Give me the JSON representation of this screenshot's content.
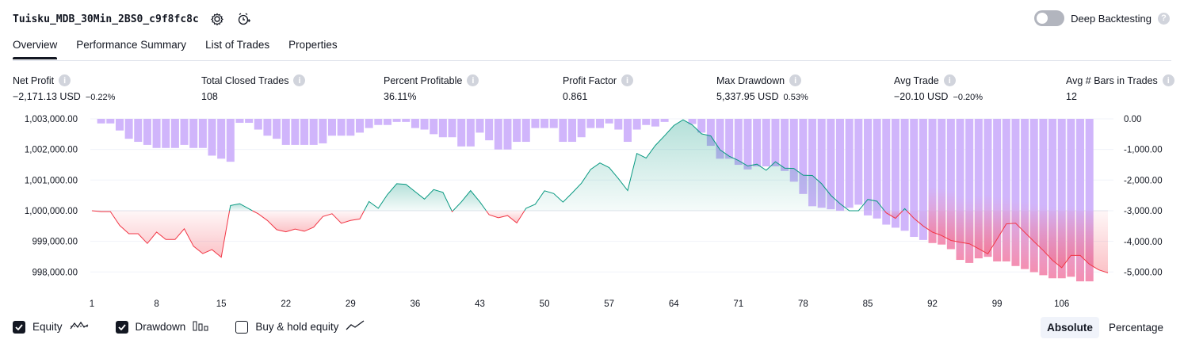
{
  "strategy": {
    "title": "Tuisku_MDB_30Min_2BS0_c9f8fc8c",
    "settings_icon": "settings-gear-icon",
    "alert_icon": "add-alert-clock-icon"
  },
  "deep_backtesting": {
    "label": "Deep Backtesting",
    "enabled": false,
    "help": "?"
  },
  "tabs": [
    {
      "label": "Overview",
      "active": true
    },
    {
      "label": "Performance Summary",
      "active": false
    },
    {
      "label": "List of Trades",
      "active": false
    },
    {
      "label": "Properties",
      "active": false
    }
  ],
  "metrics": {
    "net_profit": {
      "label": "Net Profit",
      "value": "−2,171.13 USD",
      "pct": "−0.22%"
    },
    "total_closed_trades": {
      "label": "Total Closed Trades",
      "value": "108"
    },
    "percent_profitable": {
      "label": "Percent Profitable",
      "value": "36.11%"
    },
    "profit_factor": {
      "label": "Profit Factor",
      "value": "0.861"
    },
    "max_drawdown": {
      "label": "Max Drawdown",
      "value": "5,337.95 USD",
      "pct": "0.53%"
    },
    "avg_trade": {
      "label": "Avg Trade",
      "value": "−20.10 USD",
      "pct": "−0.20%"
    },
    "avg_bars": {
      "label": "Avg # Bars in Trades",
      "value": "12"
    },
    "info_icon": "i"
  },
  "chart_data": {
    "type": "line",
    "baseline": 1000000,
    "left_axis": {
      "ticks": [
        "1,003,000.00",
        "1,002,000.00",
        "1,001,000.00",
        "1,000,000.00",
        "999,000.00",
        "998,000.00"
      ],
      "range": [
        997800,
        1003000
      ]
    },
    "right_axis": {
      "ticks": [
        "0.00",
        "-1,000.00",
        "-2,000.00",
        "-3,000.00",
        "-4,000.00",
        "-5,000.00"
      ],
      "range": [
        -5400,
        0
      ]
    },
    "x_ticks": [
      "1",
      "8",
      "15",
      "22",
      "29",
      "36",
      "43",
      "50",
      "57",
      "64",
      "71",
      "78",
      "85",
      "92",
      "99",
      "106"
    ],
    "colors": {
      "profit_line": "#089981",
      "loss_line": "#f23645",
      "drawdown_bar": "#d0b5fb",
      "drawdown_bar_deep": "#f48fb1",
      "grid": "#f0f3fa"
    },
    "series": [
      {
        "name": "Equity",
        "values": [
          1000000,
          999970,
          999970,
          999520,
          999250,
          999250,
          998930,
          999300,
          999060,
          999060,
          999410,
          998840,
          998600,
          998730,
          998480,
          1000170,
          1000230,
          1000060,
          999900,
          999680,
          999380,
          999310,
          999400,
          999330,
          999460,
          999810,
          999900,
          999590,
          999680,
          999730,
          1000300,
          1000080,
          1000530,
          1000880,
          1000860,
          1000620,
          1000380,
          1000690,
          1000600,
          999970,
          1000290,
          1000660,
          1000290,
          999870,
          999770,
          999840,
          999600,
          1000080,
          1000210,
          1000650,
          1000560,
          1000280,
          1000580,
          1000900,
          1001350,
          1001560,
          1001410,
          1001050,
          1000660,
          1001870,
          1001720,
          1002130,
          1002450,
          1002780,
          1002970,
          1002800,
          1002510,
          1002440,
          1001990,
          1001780,
          1001640,
          1001460,
          1001520,
          1001320,
          1001600,
          1001390,
          1001380,
          1001160,
          1001150,
          1000880,
          1000500,
          1000230,
          1000000,
          1000000,
          1000370,
          1000310,
          999930,
          999750,
          1000070,
          999750,
          999500,
          999300,
          999190,
          999030,
          998970,
          998920,
          998760,
          998590,
          999070,
          999570,
          999590,
          999290,
          998990,
          998700,
          998380,
          998140,
          998540,
          998540,
          998250,
          998070,
          997970
        ]
      },
      {
        "name": "Drawdown",
        "values": [
          0,
          -150,
          -150,
          -380,
          -650,
          -750,
          -850,
          -950,
          -950,
          -950,
          -850,
          -950,
          -950,
          -1200,
          -1300,
          -1400,
          -130,
          -130,
          -350,
          -550,
          -650,
          -850,
          -850,
          -850,
          -850,
          -800,
          -550,
          -550,
          -550,
          -450,
          -300,
          -200,
          -200,
          -100,
          -100,
          -300,
          -350,
          -500,
          -600,
          -600,
          -900,
          -900,
          -450,
          -700,
          -1000,
          -1000,
          -750,
          -750,
          -300,
          -300,
          -300,
          -750,
          -750,
          -600,
          -300,
          -300,
          -150,
          -350,
          -750,
          -350,
          -200,
          -250,
          -100,
          0,
          0,
          -170,
          -450,
          -880,
          -1300,
          -1300,
          -1500,
          -1650,
          -1550,
          -1550,
          -1550,
          -1700,
          -2050,
          -2450,
          -2850,
          -2900,
          -2950,
          -3000,
          -2900,
          -2800,
          -3150,
          -3250,
          -3450,
          -3550,
          -3650,
          -3850,
          -3950,
          -4050,
          -4100,
          -4250,
          -4600,
          -4700,
          -4550,
          -4500,
          -4650,
          -4650,
          -4800,
          -4900,
          -5000,
          -5100,
          -5200,
          -5200,
          -5150,
          -5300,
          -5300
        ]
      }
    ]
  },
  "legend": [
    {
      "label": "Equity",
      "checked": true,
      "icon": "equity-line-icon"
    },
    {
      "label": "Drawdown",
      "checked": true,
      "icon": "drawdown-bars-icon"
    },
    {
      "label": "Buy & hold equity",
      "checked": false,
      "icon": "buy-hold-line-icon"
    }
  ],
  "scale_toggle": {
    "options": [
      "Absolute",
      "Percentage"
    ],
    "selected": "Absolute"
  }
}
